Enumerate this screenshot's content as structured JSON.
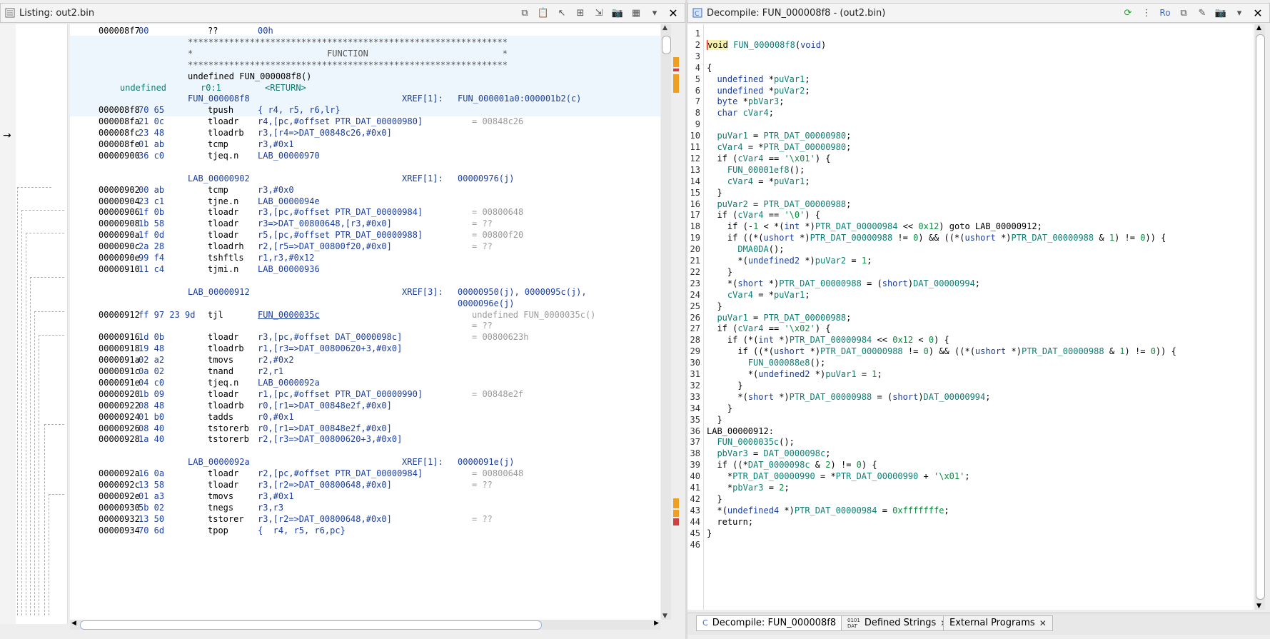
{
  "listing": {
    "title": "Listing:  out2.bin",
    "rows": [
      {
        "addr": "000008f7",
        "bytes": "00",
        "mnem": "??",
        "oper": "00h",
        "comment": "",
        "hl": false
      },
      {
        "type": "banner",
        "text": "**************************************************************",
        "hl": true
      },
      {
        "type": "banner",
        "text": "*                          FUNCTION                          *",
        "hl": true
      },
      {
        "type": "banner",
        "text": "**************************************************************",
        "hl": true
      },
      {
        "type": "sig",
        "text": "undefined FUN_000008f8()",
        "hl": true
      },
      {
        "type": "ret",
        "a": "undefined",
        "b": "r0:1",
        "c": "<RETURN>",
        "hl": true
      },
      {
        "type": "label",
        "name": "FUN_000008f8",
        "xref": "XREF[1]:",
        "xreftarget": "FUN_000001a0:000001b2(c)",
        "hl": true
      },
      {
        "addr": "000008f8",
        "bytes": "70 65",
        "mnem": "tpush",
        "oper": "{ r4, r5, r6,lr}",
        "comment": "",
        "hl": true
      },
      {
        "addr": "000008fa",
        "bytes": "21 0c",
        "mnem": "tloadr",
        "oper": "r4,[pc,#offset PTR_DAT_00000980]",
        "comment": "= 00848c26",
        "hl": false
      },
      {
        "addr": "000008fc",
        "bytes": "23 48",
        "mnem": "tloadrb",
        "oper": "r3,[r4=>DAT_00848c26,#0x0]",
        "comment": "",
        "hl": false
      },
      {
        "addr": "000008fe",
        "bytes": "01 ab",
        "mnem": "tcmp",
        "oper": "r3,#0x1",
        "comment": "",
        "hl": false
      },
      {
        "addr": "00000900",
        "bytes": "36 c0",
        "mnem": "tjeq.n",
        "oper": "LAB_00000970",
        "comment": "",
        "hl": false
      },
      {
        "type": "blank"
      },
      {
        "type": "label",
        "name": "LAB_00000902",
        "xref": "XREF[1]:",
        "xreftarget": "00000976(j)",
        "hl": false
      },
      {
        "addr": "00000902",
        "bytes": "00 ab",
        "mnem": "tcmp",
        "oper": "r3,#0x0",
        "comment": "",
        "hl": false
      },
      {
        "addr": "00000904",
        "bytes": "23 c1",
        "mnem": "tjne.n",
        "oper": "LAB_0000094e",
        "comment": "",
        "hl": false
      },
      {
        "addr": "00000906",
        "bytes": "1f 0b",
        "mnem": "tloadr",
        "oper": "r3,[pc,#offset PTR_DAT_00000984]",
        "comment": "= 00800648",
        "hl": false
      },
      {
        "addr": "00000908",
        "bytes": "1b 58",
        "mnem": "tloadr",
        "oper": "r3=>DAT_00800648,[r3,#0x0]",
        "comment": "= ??",
        "hl": false
      },
      {
        "addr": "0000090a",
        "bytes": "1f 0d",
        "mnem": "tloadr",
        "oper": "r5,[pc,#offset PTR_DAT_00000988]",
        "comment": "= 00800f20",
        "hl": false
      },
      {
        "addr": "0000090c",
        "bytes": "2a 28",
        "mnem": "tloadrh",
        "oper": "r2,[r5=>DAT_00800f20,#0x0]",
        "comment": "= ??",
        "hl": false
      },
      {
        "addr": "0000090e",
        "bytes": "99 f4",
        "mnem": "tshftls",
        "oper": "r1,r3,#0x12",
        "comment": "",
        "hl": false
      },
      {
        "addr": "00000910",
        "bytes": "11 c4",
        "mnem": "tjmi.n",
        "oper": "LAB_00000936",
        "comment": "",
        "hl": false
      },
      {
        "type": "blank"
      },
      {
        "type": "label",
        "name": "LAB_00000912",
        "xref": "XREF[3]:",
        "xreftarget": "00000950(j), 0000095c(j),",
        "hl": false
      },
      {
        "type": "xrefcont",
        "text": "0000096e(j)"
      },
      {
        "addr": "00000912",
        "bytes": "ff 97 23 9d",
        "mnem": "tjl",
        "oper": "FUN_0000035c",
        "comment": "undefined FUN_0000035c()",
        "hl": false,
        "underline": true
      },
      {
        "type": "commentonly",
        "text": "= ??"
      },
      {
        "addr": "00000916",
        "bytes": "1d 0b",
        "mnem": "tloadr",
        "oper": "r3,[pc,#offset DAT_0000098c]",
        "comment": "= 00800623h",
        "hl": false
      },
      {
        "addr": "00000918",
        "bytes": "19 48",
        "mnem": "tloadrb",
        "oper": "r1,[r3=>DAT_00800620+3,#0x0]",
        "comment": "",
        "hl": false
      },
      {
        "addr": "0000091a",
        "bytes": "02 a2",
        "mnem": "tmovs",
        "oper": "r2,#0x2",
        "comment": "",
        "hl": false
      },
      {
        "addr": "0000091c",
        "bytes": "0a 02",
        "mnem": "tnand",
        "oper": "r2,r1",
        "comment": "",
        "hl": false
      },
      {
        "addr": "0000091e",
        "bytes": "04 c0",
        "mnem": "tjeq.n",
        "oper": "LAB_0000092a",
        "comment": "",
        "hl": false
      },
      {
        "addr": "00000920",
        "bytes": "1b 09",
        "mnem": "tloadr",
        "oper": "r1,[pc,#offset PTR_DAT_00000990]",
        "comment": "= 00848e2f",
        "hl": false
      },
      {
        "addr": "00000922",
        "bytes": "08 48",
        "mnem": "tloadrb",
        "oper": "r0,[r1=>DAT_00848e2f,#0x0]",
        "comment": "",
        "hl": false
      },
      {
        "addr": "00000924",
        "bytes": "01 b0",
        "mnem": "tadds",
        "oper": "r0,#0x1",
        "comment": "",
        "hl": false
      },
      {
        "addr": "00000926",
        "bytes": "08 40",
        "mnem": "tstorerb",
        "oper": "r0,[r1=>DAT_00848e2f,#0x0]",
        "comment": "",
        "hl": false
      },
      {
        "addr": "00000928",
        "bytes": "1a 40",
        "mnem": "tstorerb",
        "oper": "r2,[r3=>DAT_00800620+3,#0x0]",
        "comment": "",
        "hl": false
      },
      {
        "type": "blank"
      },
      {
        "type": "label",
        "name": "LAB_0000092a",
        "xref": "XREF[1]:",
        "xreftarget": "0000091e(j)",
        "hl": false
      },
      {
        "addr": "0000092a",
        "bytes": "16 0a",
        "mnem": "tloadr",
        "oper": "r2,[pc,#offset PTR_DAT_00000984]",
        "comment": "= 00800648",
        "hl": false
      },
      {
        "addr": "0000092c",
        "bytes": "13 58",
        "mnem": "tloadr",
        "oper": "r3,[r2=>DAT_00800648,#0x0]",
        "comment": "= ??",
        "hl": false
      },
      {
        "addr": "0000092e",
        "bytes": "01 a3",
        "mnem": "tmovs",
        "oper": "r3,#0x1",
        "comment": "",
        "hl": false
      },
      {
        "addr": "00000930",
        "bytes": "5b 02",
        "mnem": "tnegs",
        "oper": "r3,r3",
        "comment": "",
        "hl": false
      },
      {
        "addr": "00000932",
        "bytes": "13 50",
        "mnem": "tstorer",
        "oper": "r3,[r2=>DAT_00800648,#0x0]",
        "comment": "= ??",
        "hl": false
      },
      {
        "addr": "00000934",
        "bytes": "70 6d",
        "mnem": "tpop",
        "oper": "{  r4, r5, r6,pc}",
        "comment": "",
        "hl": false
      }
    ]
  },
  "decompile": {
    "title": "Decompile: FUN_000008f8 - (out2.bin)",
    "lines": [
      "",
      "void FUN_000008f8(void)",
      "",
      "{",
      "  undefined *puVar1;",
      "  undefined *puVar2;",
      "  byte *pbVar3;",
      "  char cVar4;",
      "  ",
      "  puVar1 = PTR_DAT_00000980;",
      "  cVar4 = *PTR_DAT_00000980;",
      "  if (cVar4 == '\\x01') {",
      "    FUN_00001ef8();",
      "    cVar4 = *puVar1;",
      "  }",
      "  puVar2 = PTR_DAT_00000988;",
      "  if (cVar4 == '\\0') {",
      "    if (-1 < *(int *)PTR_DAT_00000984 << 0x12) goto LAB_00000912;",
      "    if ((*(ushort *)PTR_DAT_00000988 != 0) && ((*(ushort *)PTR_DAT_00000988 & 1) != 0)) {",
      "      DMA0DA();",
      "      *(undefined2 *)puVar2 = 1;",
      "    }",
      "    *(short *)PTR_DAT_00000988 = (short)DAT_00000994;",
      "    cVar4 = *puVar1;",
      "  }",
      "  puVar1 = PTR_DAT_00000988;",
      "  if (cVar4 == '\\x02') {",
      "    if (*(int *)PTR_DAT_00000984 << 0x12 < 0) {",
      "      if ((*(ushort *)PTR_DAT_00000988 != 0) && ((*(ushort *)PTR_DAT_00000988 & 1) != 0)) {",
      "        FUN_000088e8();",
      "        *(undefined2 *)puVar1 = 1;",
      "      }",
      "      *(short *)PTR_DAT_00000988 = (short)DAT_00000994;",
      "    }",
      "  }",
      "LAB_00000912:",
      "  FUN_0000035c();",
      "  pbVar3 = DAT_0000098c;",
      "  if ((*DAT_0000098c & 2) != 0) {",
      "    *PTR_DAT_00000990 = *PTR_DAT_00000990 + '\\x01';",
      "    *pbVar3 = 2;",
      "  }",
      "  *(undefined4 *)PTR_DAT_00000984 = 0xfffffffe;",
      "  return;",
      "}",
      ""
    ],
    "tabs": [
      {
        "label": "Decompile: FUN_000008f8",
        "active": true
      },
      {
        "label": "Defined Strings",
        "active": false
      },
      {
        "label": "External Programs",
        "active": false
      }
    ]
  },
  "colors": {
    "keyword": "#1a3fa0",
    "identifier": "#0d7d74",
    "number": "#0b8a40",
    "highlight": "#eef6fd"
  }
}
